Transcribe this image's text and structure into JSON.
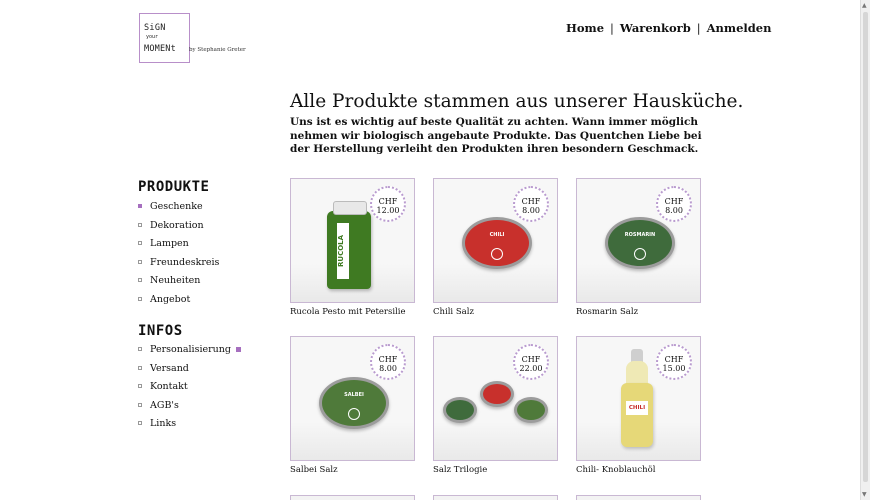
{
  "logo": {
    "line1": "SiGN",
    "line2": "your",
    "line3": "MOMENt",
    "byline": "by Stephanie Greter"
  },
  "topnav": {
    "home": "Home",
    "cart": "Warenkorb",
    "login": "Anmelden",
    "separator": "|"
  },
  "headline": "Alle Produkte stammen aus unserer Hausküche.",
  "intro": "Uns ist es wichtig auf beste Qualität zu achten. Wann immer möglich nehmen wir biologisch angebaute Produkte. Das Quentchen Liebe bei der Herstellung verleiht den Produkten ihren besondern Geschmack.",
  "sidebar": {
    "produkte_title": "Produkte",
    "produkte_items": [
      "Geschenke",
      "Dekoration",
      "Lampen",
      "Freundeskreis",
      "Neuheiten",
      "Angebot"
    ],
    "infos_title": "Infos",
    "infos_items": [
      "Personalisierung",
      "Versand",
      "Kontakt",
      "AGB's",
      "Links"
    ]
  },
  "products": [
    {
      "name": "Rucola Pesto mit Petersilie",
      "currency": "CHF",
      "price": "12.00",
      "jar_label": "RUCOLA"
    },
    {
      "name": "Chili Salz",
      "currency": "CHF",
      "price": "8.00",
      "tin_label": "CHILI"
    },
    {
      "name": "Rosmarin Salz",
      "currency": "CHF",
      "price": "8.00",
      "tin_label": "ROSMARIN"
    },
    {
      "name": "Salbei Salz",
      "currency": "CHF",
      "price": "8.00",
      "tin_label": "SALBEI"
    },
    {
      "name": "Salz Trilogie",
      "currency": "CHF",
      "price": "22.00"
    },
    {
      "name": "Chili- Knoblauchöl",
      "currency": "CHF",
      "price": "15.00",
      "bottle_label": "CHILI"
    }
  ],
  "colors": {
    "accent": "#a66fbf",
    "tin_red": "#c8302c",
    "tin_green": "#3f6b3c",
    "pesto_green": "#3f7a22",
    "oil_yellow": "#e6d878"
  }
}
